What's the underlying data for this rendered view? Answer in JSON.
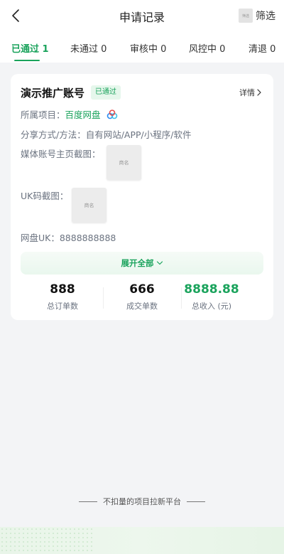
{
  "header": {
    "title": "申请记录",
    "filter_label": "筛选",
    "filter_icon_text": "筛选"
  },
  "tabs": [
    {
      "label": "已通过",
      "count": "1",
      "active": true
    },
    {
      "label": "未通过",
      "count": "0",
      "active": false
    },
    {
      "label": "审核中",
      "count": "0",
      "active": false
    },
    {
      "label": "风控中",
      "count": "0",
      "active": false
    },
    {
      "label": "清退",
      "count": "0",
      "active": false
    }
  ],
  "card": {
    "title": "演示推广账号",
    "status_badge": "已通过",
    "detail_link": "详情",
    "project_label": "所属项目：",
    "project_value": "百度网盘",
    "share_label": "分享方式/方法：",
    "share_value": "自有网站/APP/小程序/软件",
    "media_label": "媒体账号主页截图：",
    "media_thumb_text": "商名",
    "uk_label": "UK码截图：",
    "uk_thumb_text": "商名",
    "pan_uk_label": "网盘UK：",
    "pan_uk_value": "8888888888",
    "expand_label": "展开全部",
    "stats": [
      {
        "value": "888",
        "label": "总订单数"
      },
      {
        "value": "666",
        "label": "成交单数"
      },
      {
        "value": "8888.88",
        "label": "总收入 (元)"
      }
    ]
  },
  "footer": {
    "text": "不扣量的项目拉新平台"
  },
  "colors": {
    "accent": "#1aa35c",
    "page_bg": "#f3f4f6",
    "muted_text": "#6b7380"
  }
}
